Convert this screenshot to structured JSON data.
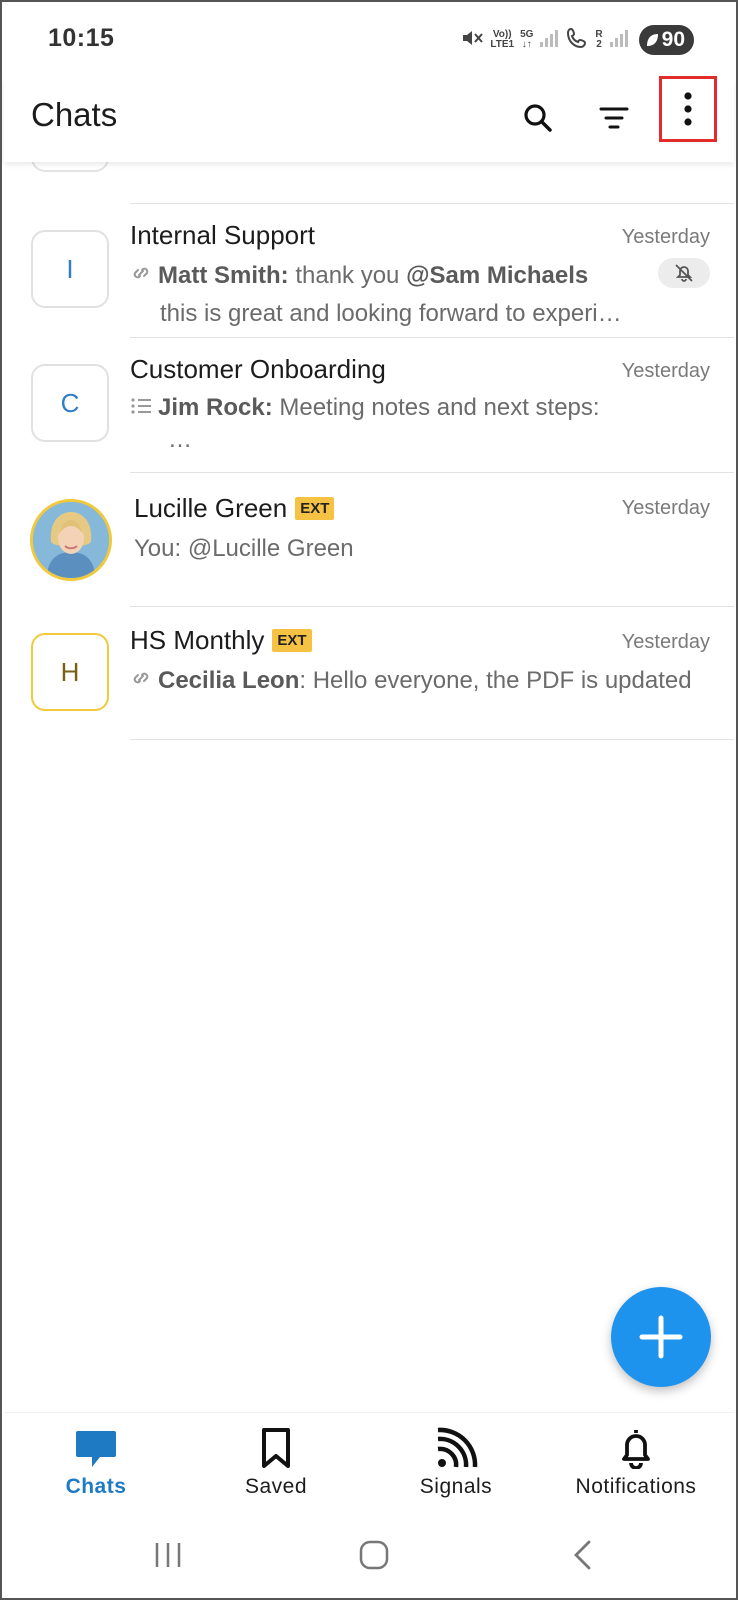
{
  "status_bar": {
    "time": "10:15",
    "volte_top": "Vo))",
    "volte_bottom": "LTE1",
    "network": "5G",
    "sim2_roaming": "R",
    "sim2_index": "2",
    "battery": "90"
  },
  "header": {
    "title": "Chats",
    "icons": [
      "search-icon",
      "filter-icon",
      "more-vertical-icon"
    ]
  },
  "chats": [
    {
      "name": "Internal Support",
      "avatar_letter": "I",
      "time": "Yesterday",
      "sender": "Matt Smith:",
      "message_part1": " thank you ",
      "mention": "@Sam Michaels",
      "message_line2": "this is great and looking forward to experi…",
      "icon": "link-icon",
      "muted": true
    },
    {
      "name": "Customer Onboarding",
      "avatar_letter": "C",
      "time": "Yesterday",
      "sender": "Jim Rock:",
      "message": " Meeting notes and next steps:",
      "message_line2": "…",
      "icon": "list-icon"
    },
    {
      "name": "Lucille Green",
      "badge": "EXT",
      "time": "Yesterday",
      "message": "You: @Lucille Green"
    },
    {
      "name": "HS Monthly",
      "badge": "EXT",
      "avatar_letter": "H",
      "time": "Yesterday",
      "sender": "Cecilia Leon",
      "message": ": Hello everyone, the PDF is updated",
      "icon": "link-icon"
    }
  ],
  "bottom_nav": [
    {
      "label": "Chats",
      "icon": "chat-bubble-icon",
      "active": true
    },
    {
      "label": "Saved",
      "icon": "bookmark-icon"
    },
    {
      "label": "Signals",
      "icon": "signals-icon"
    },
    {
      "label": "Notifications",
      "icon": "bell-icon"
    }
  ],
  "colors": {
    "accent": "#1E93EE",
    "active_nav": "#1F7AC4",
    "ext_badge": "#F6C244",
    "highlight_box": "#E22B2B"
  }
}
